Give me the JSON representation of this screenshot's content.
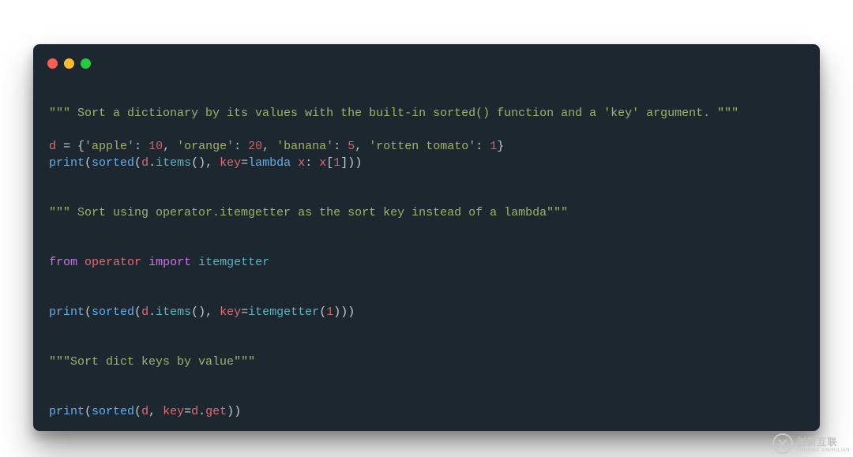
{
  "traffic": {
    "red": "#ff5f56",
    "yellow": "#ffbd2e",
    "green": "#27c93f"
  },
  "code": {
    "doc1_open": "\"\"\"",
    "doc1_body": " Sort a dictionary by its values with the built-in sorted() function and a 'key' argument. ",
    "doc1_close": "\"\"\"",
    "assign_var": "d",
    "assign_eq": " = ",
    "brace_open": "{",
    "k1": "'apple'",
    "colon": ": ",
    "v1": "10",
    "comma": ", ",
    "k2": "'orange'",
    "v2": "20",
    "k3": "'banana'",
    "v3": "5",
    "k4": "'rotten tomato'",
    "v4": "1",
    "brace_close": "}",
    "print": "print",
    "paren_open": "(",
    "sorted": "sorted",
    "d_var": "d",
    "dot": ".",
    "items": "items",
    "empty_call": "()",
    "comma_sp": ", ",
    "key_kw": "key",
    "eq": "=",
    "lambda": "lambda",
    "space": " ",
    "x": "x",
    "lambda_colon": ": ",
    "x_idx_open": "[",
    "one": "1",
    "x_idx_close": "]",
    "paren_close": ")",
    "doc2_open": "\"\"\"",
    "doc2_body": " Sort using operator.itemgetter as the sort key instead of a lambda",
    "doc2_close": "\"\"\"",
    "from": "from",
    "operator_mod": "operator",
    "import": "import",
    "itemgetter_imp": "itemgetter",
    "itemgetter_call": "itemgetter",
    "doc3_open": "\"\"\"",
    "doc3_body": "Sort dict keys by value",
    "doc3_close": "\"\"\"",
    "get": "get"
  },
  "watermark": {
    "zh": "创新互联",
    "en": "CHUANG XINHULIAN"
  }
}
